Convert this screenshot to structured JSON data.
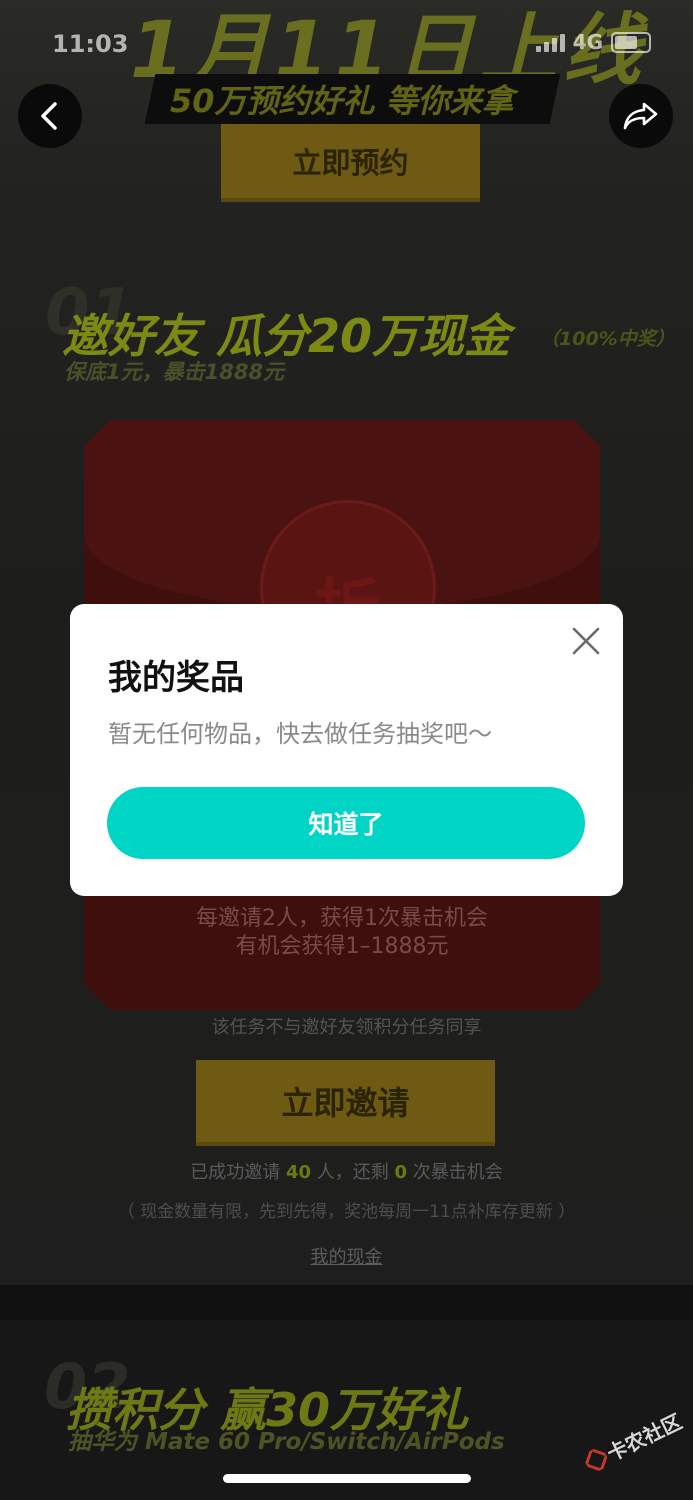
{
  "status_bar": {
    "time": "11:03",
    "network": "4G"
  },
  "hero": {
    "title": "1月11日上线",
    "subtitle": "50万预约好礼 等你来拿",
    "reserve_button": "立即预约"
  },
  "nav": {
    "back_icon": "chevron-left-icon",
    "share_icon": "share-icon"
  },
  "section1": {
    "number": "01",
    "title": "邀好友 瓜分20万现金",
    "tag": "（100%中奖）",
    "subtitle": "保底1元，暴击1888元",
    "card": {
      "open_label": "拆",
      "line1": "每邀请2人，获得1次暴击机会",
      "line2": "有机会获得1–1888元"
    },
    "not_shared_note": "该任务不与邀好友领积分任务同享",
    "invite_button": "立即邀请",
    "invite_status": {
      "prefix": "已成功邀请 ",
      "invited_count": "40",
      "middle": " 人，还剩 ",
      "remaining_count": "0",
      "suffix": " 次暴击机会"
    },
    "cash_note": "（ 现金数量有限，先到先得，奖池每周一11点补库存更新 ）",
    "my_cash_link": "我的现金"
  },
  "section2": {
    "number": "02",
    "title": "攒积分 赢30万好礼",
    "subtitle": "抽华为 Mate 60 Pro/Switch/AirPods"
  },
  "watermark": {
    "text": "卡农社区"
  },
  "modal": {
    "title": "我的奖品",
    "message": "暂无任何物品，快去做任务抽奖吧～",
    "confirm_button": "知道了",
    "close_icon": "close-icon"
  },
  "colors": {
    "accent_teal": "#00d5c5",
    "dim_background": "#1d1d1c",
    "highlight_green": "#6c7a13"
  }
}
